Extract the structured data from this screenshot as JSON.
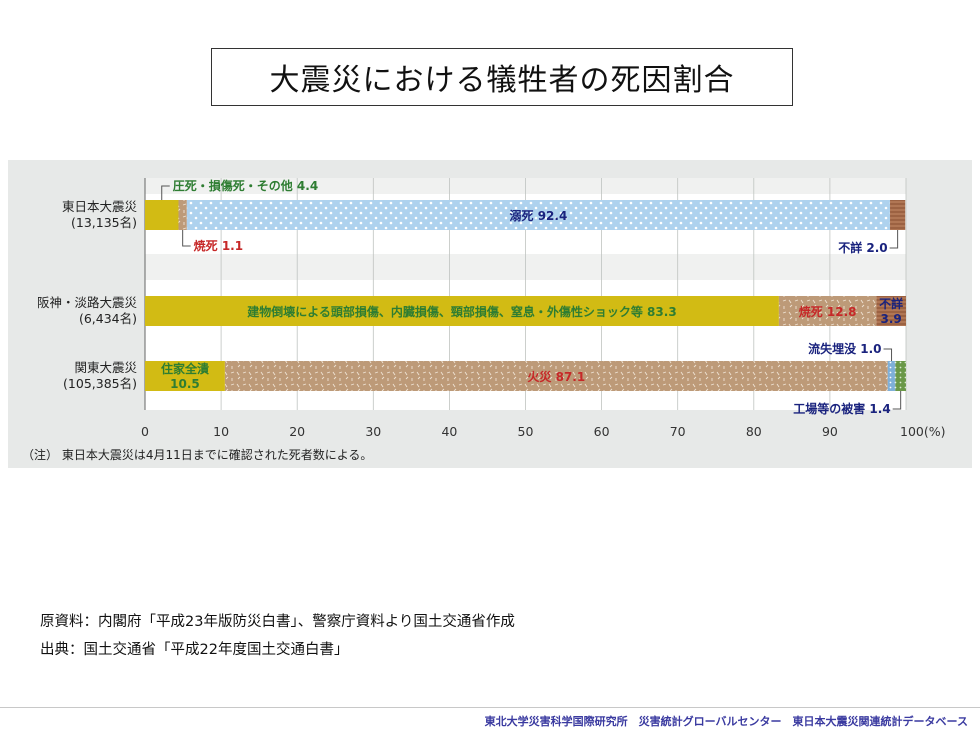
{
  "title": "大震災における犠牲者の死因割合",
  "note": "（注） 東日本大震災は4月11日までに確認された死者数による。",
  "sources": [
    "原資料：内閣府「平成23年版防災白書」、警察庁資料より国土交通省作成",
    "出典：国土交通省「平成22年度国土交通白書」"
  ],
  "footer": "東北大学災害科学国際研究所　災害統計グローバルセンター　東日本大震災関連統計データベース",
  "colors": {
    "crush": "#d2bb14",
    "drown": "#aed2ee",
    "fire": "#bd9a78",
    "unknown": "#9c6242",
    "buried": "#7fb0d8",
    "factory": "#6a9848",
    "panel": "#e7e9e8",
    "label_green": "#2e7d32",
    "label_red": "#c62828",
    "label_navy": "#1a237e"
  },
  "chart_data": {
    "type": "bar",
    "orientation": "horizontal",
    "stacked": true,
    "xlim": [
      0,
      100
    ],
    "x_ticks": [
      "0",
      "10",
      "20",
      "30",
      "40",
      "50",
      "60",
      "70",
      "80",
      "90",
      "100(%)"
    ],
    "grid": true,
    "categories": [
      {
        "name": "東日本大震災",
        "count": "(13,135名)"
      },
      {
        "name": "阪神・淡路大震災",
        "count": "(6,434名)"
      },
      {
        "name": "関東大震災",
        "count": "(105,385名)"
      }
    ],
    "bars": [
      [
        {
          "key": "crush",
          "value": 4.4,
          "label": "圧死・損傷死・その他 4.4",
          "label_color": "label_green",
          "callout": "above"
        },
        {
          "key": "fire",
          "value": 1.1,
          "label": "焼死 1.1",
          "label_color": "label_red",
          "callout": "below"
        },
        {
          "key": "drown",
          "value": 92.4,
          "label": "溺死 92.4",
          "label_color": "label_navy",
          "callout": "inside"
        },
        {
          "key": "unknown",
          "value": 2.0,
          "label": "不詳 2.0",
          "label_color": "label_navy",
          "callout": "below-right"
        }
      ],
      [
        {
          "key": "crush",
          "value": 83.3,
          "label": "建物倒壊による頭部損傷、内臓損傷、頸部損傷、窒息・外傷性ショック等 83.3",
          "label_color": "label_green",
          "callout": "inside"
        },
        {
          "key": "fire",
          "value": 12.8,
          "label": "焼死 12.8",
          "label_color": "label_red",
          "callout": "inside"
        },
        {
          "key": "unknown",
          "value": 3.9,
          "label": "不詳 3.9",
          "label_color": "label_navy",
          "callout": "inside-stacked"
        }
      ],
      [
        {
          "key": "crush",
          "value": 10.5,
          "label": "住家全潰 10.5",
          "label_color": "label_green",
          "callout": "inside-stacked"
        },
        {
          "key": "fire",
          "value": 87.1,
          "label": "火災 87.1",
          "label_color": "label_red",
          "callout": "inside"
        },
        {
          "key": "buried",
          "value": 1.0,
          "label": "流失埋没 1.0",
          "label_color": "label_navy",
          "callout": "above-right"
        },
        {
          "key": "factory",
          "value": 1.4,
          "label": "工場等の被害 1.4",
          "label_color": "label_navy",
          "callout": "below-right"
        }
      ]
    ]
  }
}
